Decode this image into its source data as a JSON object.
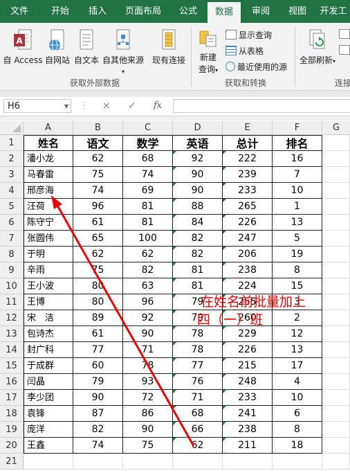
{
  "ribbon_tabs": [
    "文件",
    "开始",
    "插入",
    "页面布局",
    "公式",
    "数据",
    "审阅",
    "视图",
    "开发工"
  ],
  "active_tab": "数据",
  "get_external": {
    "access": "自 Access",
    "web": "自网站",
    "text": "自文本",
    "other": "自其他来源",
    "existing": "现有连接",
    "group": "获取外部数据"
  },
  "transform": {
    "new_query_line1": "新建",
    "new_query_line2": "查询",
    "show_queries": "显示查询",
    "from_table": "从表格",
    "recent_sources": "最近使用的源",
    "group": "获取和转换"
  },
  "connections": {
    "refresh_all": "全部刷新",
    "group": "连接"
  },
  "formula_bar": {
    "name_box": "H6",
    "fx": "fx",
    "cancel": "×",
    "enter": "✓",
    "value": ""
  },
  "columns": [
    "A",
    "B",
    "C",
    "D",
    "E",
    "F",
    "G"
  ],
  "header_row": [
    "姓名",
    "语文",
    "数学",
    "英语",
    "总计",
    "排名"
  ],
  "rows": [
    [
      "潘小龙",
      "62",
      "68",
      "92",
      "222",
      "16"
    ],
    [
      "马春雷",
      "75",
      "74",
      "90",
      "239",
      "7"
    ],
    [
      "邢彦海",
      "74",
      "69",
      "90",
      "233",
      "10"
    ],
    [
      "汪荷",
      "96",
      "81",
      "88",
      "265",
      "1"
    ],
    [
      "陈守宁",
      "61",
      "81",
      "84",
      "226",
      "13"
    ],
    [
      "张圆伟",
      "65",
      "100",
      "82",
      "247",
      "5"
    ],
    [
      "于明",
      "62",
      "62",
      "82",
      "206",
      "19"
    ],
    [
      "辛雨",
      "75",
      "82",
      "81",
      "238",
      "8"
    ],
    [
      "王小波",
      "80",
      "63",
      "81",
      "224",
      "15"
    ],
    [
      "王博",
      "80",
      "96",
      "79",
      "255",
      "3"
    ],
    [
      "宋　洁",
      "89",
      "92",
      "79",
      "260",
      "2"
    ],
    [
      "包诗杰",
      "61",
      "90",
      "78",
      "229",
      "12"
    ],
    [
      "封广科",
      "77",
      "71",
      "78",
      "226",
      "13"
    ],
    [
      "于成群",
      "60",
      "78",
      "77",
      "215",
      "17"
    ],
    [
      "闫晶",
      "79",
      "93",
      "76",
      "248",
      "4"
    ],
    [
      "李少团",
      "90",
      "72",
      "71",
      "233",
      "10"
    ],
    [
      "袁锋",
      "87",
      "86",
      "68",
      "241",
      "6"
    ],
    [
      "庞洋",
      "82",
      "90",
      "66",
      "238",
      "8"
    ],
    [
      "王鑫",
      "74",
      "75",
      "62",
      "211",
      "18"
    ]
  ],
  "row_numbers": [
    "1",
    "2",
    "3",
    "4",
    "5",
    "6",
    "7",
    "8",
    "9",
    "10",
    "11",
    "12",
    "13",
    "14",
    "15",
    "16",
    "17",
    "18",
    "19",
    "20",
    "21"
  ],
  "annotation": {
    "line1": "在姓名前批量加上",
    "line2": "四（一）班",
    "color": "#e60000"
  },
  "colors": {
    "excel_green": "#217346",
    "ribbon_bg": "#f3f3f3"
  }
}
